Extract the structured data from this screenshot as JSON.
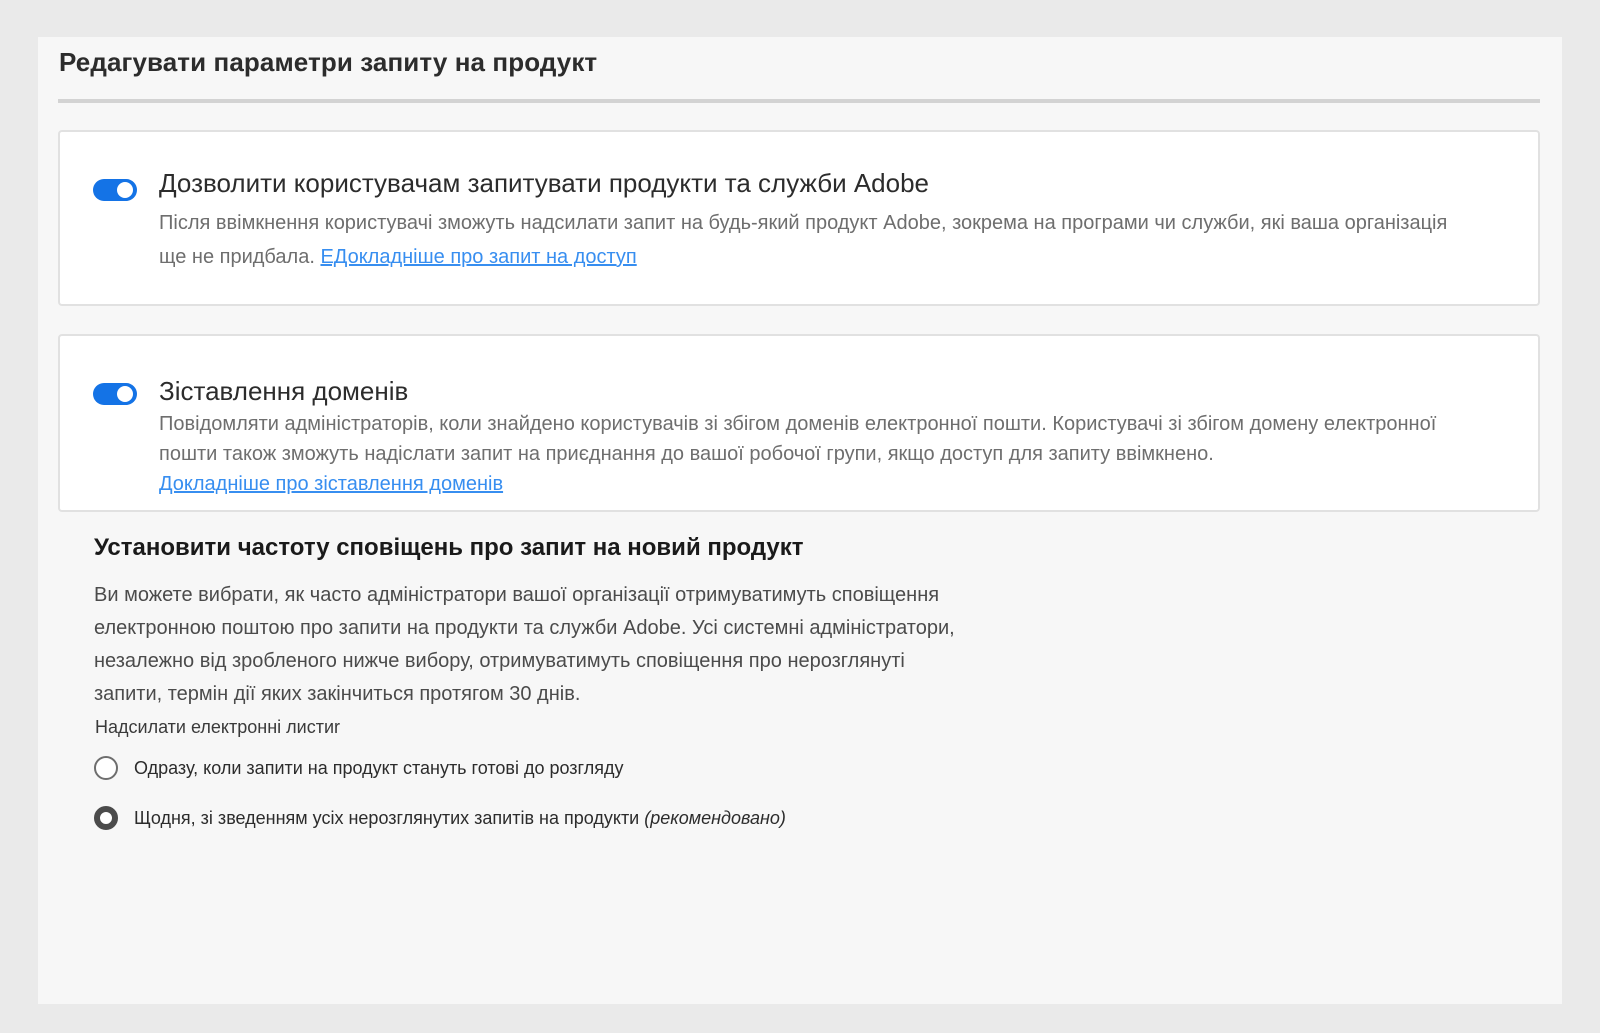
{
  "panel": {
    "title": "Редагувати параметри запиту на продукт"
  },
  "cards": [
    {
      "toggle_on": true,
      "title": "Дозволити користувачам запитувати продукти та служби Adobe",
      "description": "Після ввімкнення користувачі зможуть надсилати запит на будь-який продукт Adobe, зокрема на програми чи служби, які ваша організація ще не придбала. ",
      "link": "ЕДокладніше про запит на доступ"
    },
    {
      "toggle_on": true,
      "title": "Зіставлення доменів",
      "description": "Повідомляти адміністраторів, коли знайдено користувачів зі збігом доменів електронної пошти. Користувачі зі збігом домену електронної пошти також зможуть надіслати запит на приєднання до вашої робочої групи, якщо доступ для запиту ввімкнено.",
      "link": "Докладніше про зіставлення доменів"
    }
  ],
  "frequency": {
    "heading": "Установити частоту сповіщень про запит на новий продукт",
    "description": "Ви можете вибрати, як часто адміністратори вашої організації отримуватимуть сповіщення електронною поштою про запити на продукти та служби Adobe. Усі системні адміністратори, незалежно від зробленого нижче вибору, отримуватимуть сповіщення про нерозглянуті запити, термін дії яких закінчиться протягом 30 днів.",
    "send_label": "Надсилати електронні листиr",
    "options": [
      {
        "label": "Одразу, коли запити на продукт стануть готові до розгляду",
        "suffix": "",
        "selected": false
      },
      {
        "label": "Щодня, зі зведенням усіх нерозглянутих запитів на продукти ",
        "suffix": "(рекомендовано)",
        "selected": true
      }
    ]
  },
  "colors": {
    "accent": "#1473e6",
    "link": "#378ef0"
  }
}
